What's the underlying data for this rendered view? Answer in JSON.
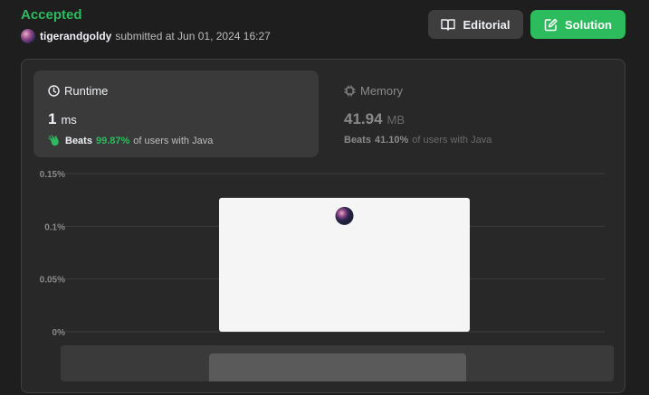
{
  "header": {
    "status": "Accepted",
    "username": "tigerandgoldy",
    "submitted_text": "submitted at Jun 01, 2024 16:27",
    "editorial_label": "Editorial",
    "solution_label": "Solution"
  },
  "runtime": {
    "title": "Runtime",
    "value": "1",
    "unit": "ms",
    "beats_label": "Beats",
    "beats_pct": "99.87%",
    "beats_suffix": "of users with Java"
  },
  "memory": {
    "title": "Memory",
    "value": "41.94",
    "unit": "MB",
    "beats_label": "Beats",
    "beats_pct": "41.10%",
    "beats_suffix": "of users with Java"
  },
  "colors": {
    "accent": "#2cbb5d",
    "background": "#1e1e1e",
    "card": "#282828"
  },
  "chart_data": {
    "type": "bar",
    "ytick_labels": [
      "0%",
      "0.05%",
      "0.1%",
      "0.15%"
    ],
    "yticks": [
      0,
      0.05,
      0.1,
      0.15
    ],
    "ylim": [
      0,
      0.15
    ],
    "values": [
      0.127
    ],
    "highlight_index": 0,
    "grid": true
  }
}
